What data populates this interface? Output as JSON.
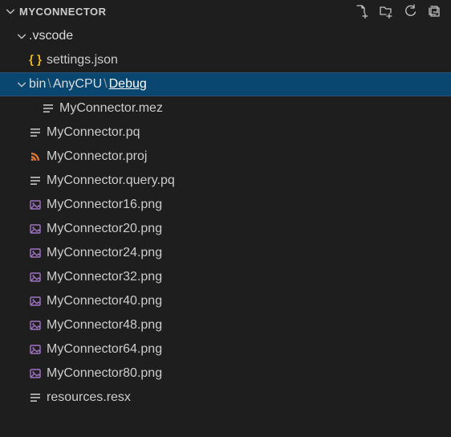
{
  "explorer": {
    "title": "MYCONNECTOR",
    "actions": {
      "new_file": "New File",
      "new_folder": "New Folder",
      "refresh": "Refresh",
      "collapse_all": "Collapse All"
    },
    "tree": {
      "vscode": {
        "name": ".vscode",
        "expanded": true,
        "children": {
          "settings": {
            "name": "settings.json",
            "icon": "json"
          }
        }
      },
      "bin": {
        "segments": [
          "bin",
          "AnyCPU",
          "Debug"
        ],
        "expanded": true,
        "selected": true,
        "children": {
          "mez": {
            "name": "MyConnector.mez",
            "icon": "lines"
          }
        }
      },
      "root_files": [
        {
          "name": "MyConnector.pq",
          "icon": "lines"
        },
        {
          "name": "MyConnector.proj",
          "icon": "rss"
        },
        {
          "name": "MyConnector.query.pq",
          "icon": "lines"
        },
        {
          "name": "MyConnector16.png",
          "icon": "image"
        },
        {
          "name": "MyConnector20.png",
          "icon": "image"
        },
        {
          "name": "MyConnector24.png",
          "icon": "image"
        },
        {
          "name": "MyConnector32.png",
          "icon": "image"
        },
        {
          "name": "MyConnector40.png",
          "icon": "image"
        },
        {
          "name": "MyConnector48.png",
          "icon": "image"
        },
        {
          "name": "MyConnector64.png",
          "icon": "image"
        },
        {
          "name": "MyConnector80.png",
          "icon": "image"
        },
        {
          "name": "resources.resx",
          "icon": "lines"
        }
      ]
    }
  }
}
